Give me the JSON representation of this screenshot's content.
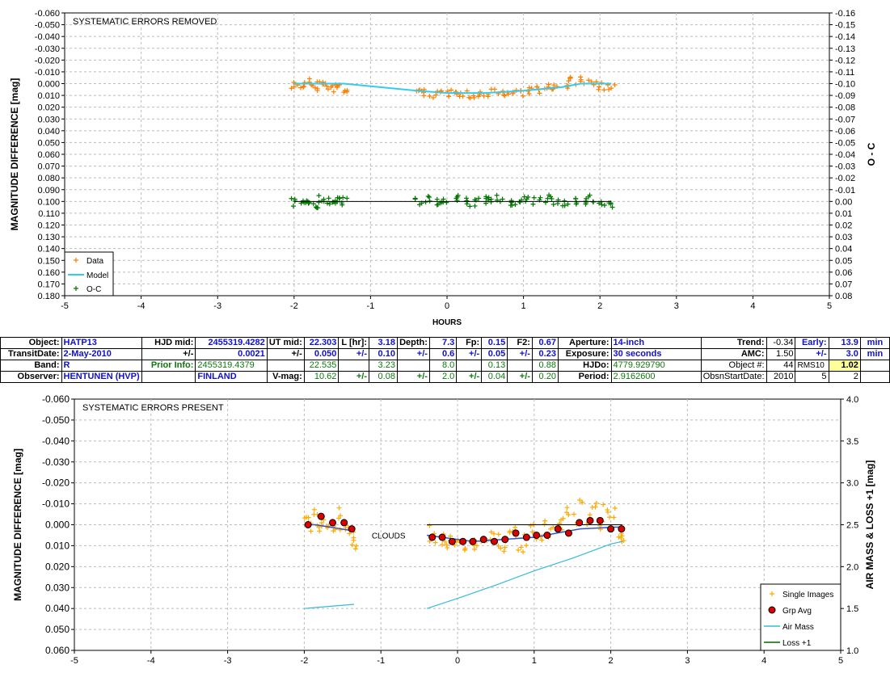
{
  "colors": {
    "data": "#ff7f00",
    "model": "#33ccee",
    "oc": "#007700",
    "single": "#ffaa00",
    "grp_fill": "#dd0000",
    "airmass": "#33bbdd",
    "loss": "#006600",
    "label_blue": "#1010d0",
    "label_green": "#0a7a0a"
  },
  "top": {
    "title": "SYSTEMATIC ERRORS REMOVED",
    "ylabel": "MAGNITUDE DIFFERENCE [mag]",
    "y2label": "O - C",
    "xlabel": "HOURS",
    "legend": {
      "data": "Data",
      "model": "Model",
      "oc": "O-C"
    }
  },
  "bottom": {
    "title": "SYSTEMATIC ERRORS PRESENT",
    "ylabel": "MAGNITUDE DIFFERENCE [mag]",
    "y2label": "AIR MASS & LOSS +1 [mag]",
    "annotation": "CLOUDS",
    "legend": {
      "single": "Single Images",
      "grp": "Grp Avg",
      "airmass": "Air Mass",
      "loss": "Loss +1"
    }
  },
  "info": {
    "r1": {
      "c1": "Object:",
      "c2": "HATP13",
      "c3": "HJD mid:",
      "c4": "2455319.4282",
      "c5": "UT mid:",
      "c6": "22.303",
      "c7": "L [hr]:",
      "c8": "3.18",
      "c9": "Depth:",
      "c10": "7.3",
      "c11": "Fp:",
      "c12": "0.15",
      "c13": "F2:",
      "c14": "0.67",
      "c15": "Aperture:",
      "c16": "14-inch",
      "c17": "Trend:",
      "c18": "-0.34",
      "c19": "Early:",
      "c20": "13.9",
      "c21": "min"
    },
    "r2": {
      "c1": "TransitDate:",
      "c2": "2-May-2010",
      "c3": "+/-",
      "c4": "0.0021",
      "c5": "+/-",
      "c6": "0.050",
      "c7": "+/-",
      "c8": "0.10",
      "c9": "+/-",
      "c10": "0.6",
      "c11": "+/-",
      "c12": "0.05",
      "c13": "+/-",
      "c14": "0.23",
      "c15": "Exposure:",
      "c16": "30 seconds",
      "c17": "AMC:",
      "c18": "1.50",
      "c19": "+/-",
      "c20": "3.0",
      "c21": "min"
    },
    "r3": {
      "c1": "Band:",
      "c2": "R",
      "c3": "Prior Info:",
      "c4": "2455319.4379",
      "c6": "22.535",
      "c8": "3.23",
      "c10": "8.0",
      "c12": "0.13",
      "c14": "0.88",
      "c15": "HJDo:",
      "c16": "4779.929790",
      "c17": "Object #:",
      "c18": "44",
      "c19": "RMS10",
      "c20": "1.02"
    },
    "r4": {
      "c1": "Observer:",
      "c2": "HENTUNEN (HVP)",
      "c4": "FINLAND",
      "c5": "V-mag:",
      "c6": "10.62",
      "c7": "+/-",
      "c8": "0.08",
      "c9": "+/-",
      "c10": "2.0",
      "c11": "+/-",
      "c12": "0.04",
      "c13": "+/-",
      "c14": "0.20",
      "c15": "Period:",
      "c16": "2.9162600",
      "c17": "ObsnStartDate:",
      "c18": "2010",
      "c19": "5",
      "c20": "2"
    }
  },
  "chart_data": [
    {
      "type": "scatter",
      "title": "SYSTEMATIC ERRORS REMOVED",
      "xlabel": "HOURS",
      "ylabel": "MAGNITUDE DIFFERENCE [mag]",
      "y2label": "O - C",
      "xlim": [
        -5,
        5
      ],
      "ylim": [
        -0.06,
        0.18
      ],
      "y_inverted": true,
      "y2lim": [
        -0.16,
        0.08
      ],
      "x_ticks": [
        -5,
        -4,
        -3,
        -2,
        -1,
        0,
        1,
        2,
        3,
        4,
        5
      ],
      "y_ticks": [
        "-0.060",
        "-0.050",
        "-0.040",
        "-0.030",
        "-0.020",
        "-0.010",
        "0.000",
        "0.010",
        "0.020",
        "0.030",
        "0.040",
        "0.050",
        "0.060",
        "0.070",
        "0.080",
        "0.090",
        "0.100",
        "0.110",
        "0.120",
        "0.130",
        "0.140",
        "0.150",
        "0.160",
        "0.170",
        "0.180"
      ],
      "y2_ticks": [
        "-0.16",
        "-0.15",
        "-0.14",
        "-0.13",
        "-0.12",
        "-0.11",
        "-0.10",
        "-0.09",
        "-0.08",
        "-0.07",
        "-0.06",
        "-0.05",
        "-0.04",
        "-0.03",
        "-0.02",
        "-0.01",
        "0.00",
        "0.01",
        "0.02",
        "0.03",
        "0.04",
        "0.05",
        "0.06",
        "0.07",
        "0.08"
      ],
      "grid": true,
      "legend_position": "bottom-left",
      "series": [
        {
          "name": "Data",
          "marker": "+",
          "x": [
            -1.98,
            -1.9,
            -1.82,
            -1.74,
            -1.66,
            -1.58,
            -1.5,
            -1.42,
            -1.35,
            -0.38,
            -0.26,
            -0.14,
            -0.02,
            0.1,
            0.22,
            0.34,
            0.46,
            0.58,
            0.7,
            0.82,
            0.94,
            1.06,
            1.18,
            1.3,
            1.42,
            1.54,
            1.66,
            1.78,
            1.9,
            2.02,
            2.14
          ],
          "y": [
            0.001,
            0.002,
            -0.001,
            0.003,
            0.0,
            0.002,
            0.004,
            0.003,
            0.006,
            0.007,
            0.008,
            0.009,
            0.008,
            0.009,
            0.008,
            0.009,
            0.009,
            0.008,
            0.007,
            0.008,
            0.007,
            0.006,
            0.005,
            0.004,
            0.003,
            0.001,
            -0.002,
            -0.003,
            -0.001,
            0.002,
            0.004
          ]
        },
        {
          "name": "Model",
          "type": "line",
          "x": [
            -2.0,
            -1.85,
            -1.35,
            -0.4,
            0.0,
            0.5,
            1.0,
            1.5,
            1.75,
            2.15
          ],
          "y": [
            0.0,
            0.0,
            0.0,
            0.006,
            0.008,
            0.008,
            0.006,
            0.003,
            0.0,
            0.0
          ]
        },
        {
          "name": "O-C",
          "marker": "+",
          "x": [
            -1.98,
            -1.9,
            -1.82,
            -1.74,
            -1.66,
            -1.58,
            -1.5,
            -1.42,
            -1.35,
            -0.38,
            -0.26,
            -0.14,
            -0.02,
            0.1,
            0.22,
            0.34,
            0.46,
            0.58,
            0.7,
            0.82,
            0.94,
            1.06,
            1.18,
            1.3,
            1.42,
            1.54,
            1.66,
            1.78,
            1.9,
            2.02,
            2.14
          ],
          "y": [
            0.101,
            0.099,
            0.1,
            0.102,
            0.098,
            0.1,
            0.101,
            0.099,
            0.1,
            0.1,
            0.099,
            0.101,
            0.1,
            0.098,
            0.1,
            0.101,
            0.099,
            0.1,
            0.098,
            0.1,
            0.101,
            0.099,
            0.1,
            0.098,
            0.1,
            0.101,
            0.099,
            0.1,
            0.098,
            0.101,
            0.103
          ]
        }
      ]
    },
    {
      "type": "scatter",
      "title": "SYSTEMATIC ERRORS PRESENT",
      "xlabel": "",
      "ylabel": "MAGNITUDE DIFFERENCE [mag]",
      "y2label": "AIR MASS & LOSS +1 [mag]",
      "xlim": [
        -5,
        5
      ],
      "ylim": [
        -0.06,
        0.06
      ],
      "y_inverted": true,
      "y2lim": [
        1.0,
        4.0
      ],
      "x_ticks": [
        -5,
        -4,
        -3,
        -2,
        -1,
        0,
        1,
        2,
        3,
        4,
        5
      ],
      "y_ticks": [
        "-0.060",
        "-0.050",
        "-0.040",
        "-0.030",
        "-0.020",
        "-0.010",
        "0.000",
        "0.010",
        "0.020",
        "0.030",
        "0.040",
        "0.050",
        "0.060"
      ],
      "y2_ticks": [
        "1.0",
        "1.5",
        "2.0",
        "2.5",
        "3.0",
        "3.5",
        "4.0"
      ],
      "grid": true,
      "legend_position": "bottom-right",
      "annotations": [
        {
          "text": "CLOUDS",
          "x": -0.9,
          "y": 0.005
        }
      ],
      "series": [
        {
          "name": "Single Images",
          "marker": "+",
          "x": [
            -1.98,
            -1.92,
            -1.86,
            -1.8,
            -1.74,
            -1.68,
            -1.62,
            -1.56,
            -1.5,
            -1.44,
            -1.38,
            -1.34,
            -0.38,
            -0.3,
            -0.22,
            -0.14,
            -0.06,
            0.02,
            0.1,
            0.18,
            0.26,
            0.34,
            0.42,
            0.5,
            0.58,
            0.66,
            0.74,
            0.82,
            0.9,
            0.98,
            1.06,
            1.14,
            1.22,
            1.3,
            1.38,
            1.46,
            1.54,
            1.62,
            1.7,
            1.78,
            1.86,
            1.94,
            2.02,
            2.1,
            2.18
          ],
          "y": [
            -0.004,
            0.002,
            -0.006,
            0.004,
            -0.002,
            0.003,
            0.0,
            -0.005,
            0.004,
            0.001,
            0.006,
            0.01,
            0.004,
            0.008,
            0.006,
            0.01,
            0.007,
            0.009,
            0.011,
            0.006,
            0.009,
            0.01,
            0.005,
            0.008,
            0.011,
            0.007,
            0.004,
            0.009,
            0.006,
            0.003,
            0.007,
            0.002,
            0.005,
            -0.002,
            0.001,
            -0.006,
            -0.003,
            -0.01,
            -0.004,
            -0.012,
            0.001,
            -0.008,
            -0.004,
            0.003,
            0.006
          ]
        },
        {
          "name": "Grp Avg",
          "marker": "o",
          "x": [
            -1.95,
            -1.78,
            -1.63,
            -1.48,
            -1.38,
            -0.33,
            -0.2,
            -0.07,
            0.07,
            0.2,
            0.34,
            0.48,
            0.62,
            0.76,
            0.9,
            1.03,
            1.17,
            1.31,
            1.45,
            1.59,
            1.73,
            1.86,
            2.0,
            2.14
          ],
          "y": [
            0.0,
            -0.004,
            -0.001,
            -0.001,
            0.002,
            0.006,
            0.006,
            0.008,
            0.008,
            0.008,
            0.007,
            0.008,
            0.007,
            0.004,
            0.006,
            0.005,
            0.005,
            0.002,
            0.004,
            -0.001,
            -0.002,
            -0.002,
            0.002,
            0.002
          ]
        },
        {
          "name": "Air Mass",
          "type": "line",
          "axis": "y2",
          "x": [
            -2.0,
            -1.35,
            -0.4,
            0.0,
            0.5,
            1.0,
            1.5,
            2.0,
            2.15
          ],
          "y": [
            1.5,
            1.55,
            1.5,
            1.62,
            1.78,
            1.95,
            2.1,
            2.27,
            2.3
          ]
        },
        {
          "name": "Loss +1",
          "type": "line",
          "axis": "y2",
          "x": [
            -2.0,
            2.15
          ],
          "y": [
            1.0,
            1.0
          ]
        }
      ]
    }
  ]
}
